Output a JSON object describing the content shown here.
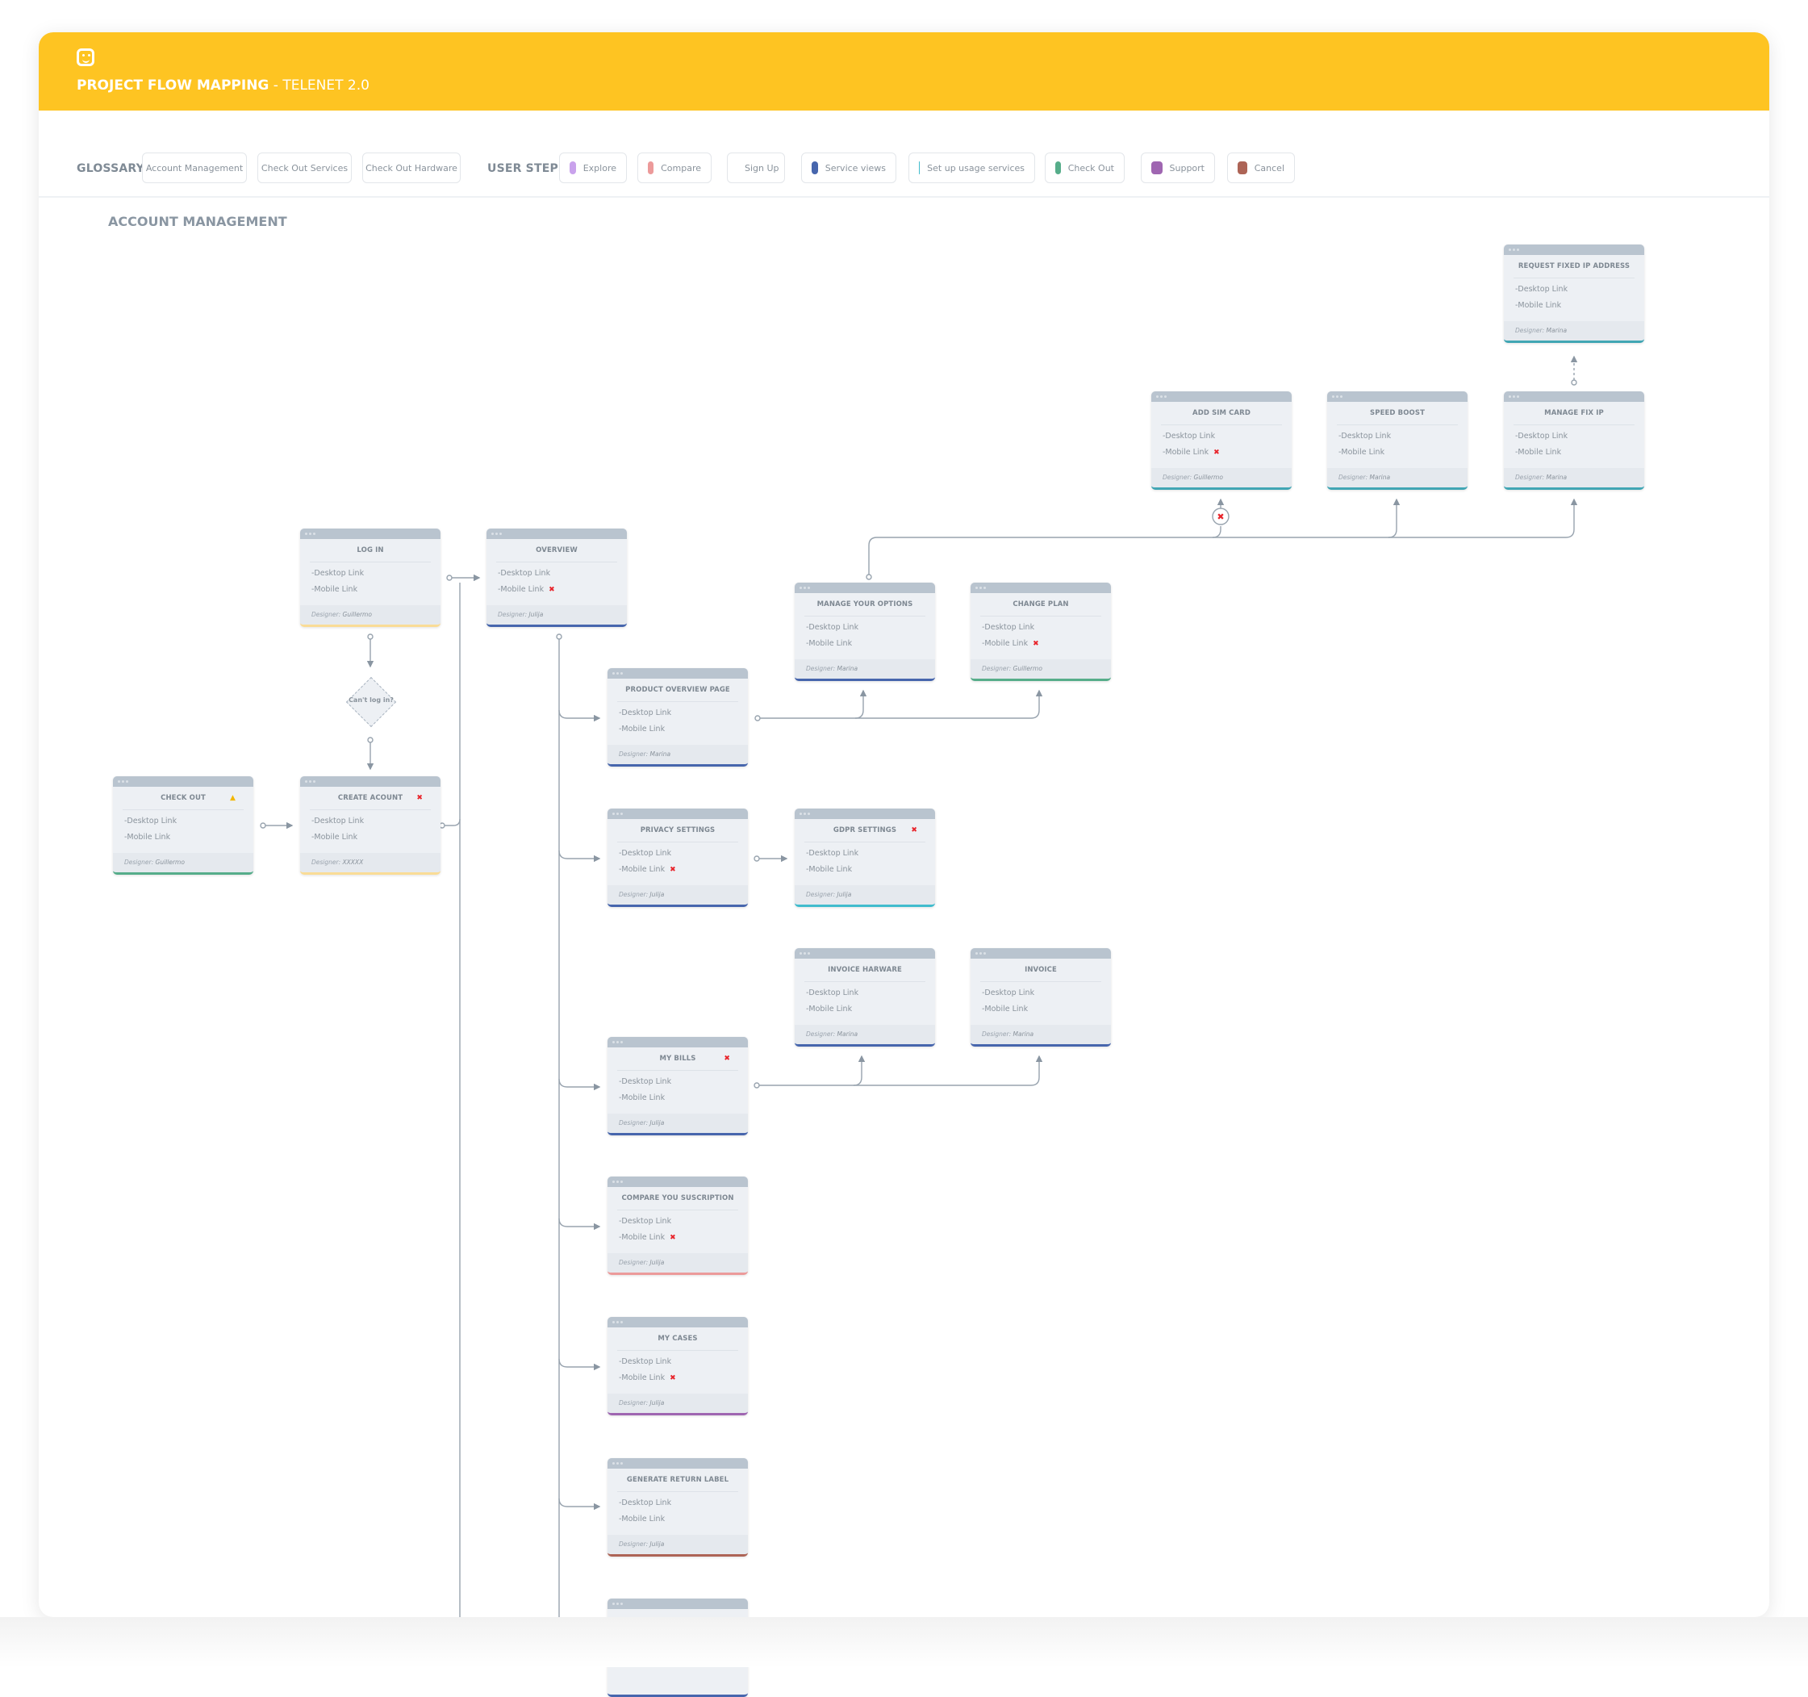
{
  "header": {
    "logo_icon": "telenet-smiley-icon",
    "title_bold": "PROJECT FLOW MAPPING",
    "title_rest": " - TELENET 2.0"
  },
  "toolbar": {
    "glossary_label": "GLOSSARY",
    "glossary": [
      "Account Management",
      "Check Out Services",
      "Check Out Hardware"
    ],
    "user_steps_label": "USER STEPS",
    "user_steps": [
      {
        "label": "Explore",
        "color": "#c9a2ec"
      },
      {
        "label": "Compare",
        "color": "#ec9a9a"
      },
      {
        "label": "Sign Up",
        "color": "#fadc96"
      },
      {
        "label": "Service views",
        "color": "#4766ad"
      },
      {
        "label": "Set up usage services",
        "color": "#41bccd"
      },
      {
        "label": "Check Out",
        "color": "#56ad8a"
      },
      {
        "label": "Support",
        "color": "#9f66b1"
      },
      {
        "label": "Cancel",
        "color": "#ad6456"
      }
    ]
  },
  "section": {
    "title": "ACCOUNT MANAGEMENT"
  },
  "common": {
    "desktop_link": "-Desktop Link",
    "mobile_link": "-Mobile Link",
    "designer_prefix": "Designer: ",
    "error_mark": "✖",
    "warning_mark": "▲"
  },
  "decision": {
    "label": "Can't log in?"
  },
  "cards": [
    {
      "id": "log-in",
      "title": "LOG IN",
      "designer": "Guillermo",
      "step_color": "#fadc96",
      "title_status": "",
      "mobile_error": false
    },
    {
      "id": "overview",
      "title": "OVERVIEW",
      "designer": "Julija",
      "step_color": "#4766ad",
      "title_status": "",
      "mobile_error": true
    },
    {
      "id": "check-out",
      "title": "CHECK OUT",
      "designer": "Guillermo",
      "step_color": "#56ad8a",
      "title_status": "warning",
      "mobile_error": false
    },
    {
      "id": "create-account",
      "title": "CREATE ACOUNT",
      "designer": "XXXXX",
      "step_color": "#fadc96",
      "title_status": "error",
      "mobile_error": false
    },
    {
      "id": "product-overview-page",
      "title": "PRODUCT OVERVIEW PAGE",
      "designer": "Marina",
      "step_color": "#4766ad",
      "title_status": "",
      "mobile_error": false
    },
    {
      "id": "privacy-settings",
      "title": "PRIVACY SETTINGS",
      "designer": "Julija",
      "step_color": "#4766ad",
      "title_status": "",
      "mobile_error": true
    },
    {
      "id": "my-bills",
      "title": "MY BILLS",
      "designer": "Julija",
      "step_color": "#4766ad",
      "title_status": "error",
      "mobile_error": false
    },
    {
      "id": "compare-subscription",
      "title": "COMPARE YOU SUSCRIPTION",
      "designer": "Julija",
      "step_color": "#ec9a9a",
      "title_status": "",
      "mobile_error": true
    },
    {
      "id": "my-cases",
      "title": "MY CASES",
      "designer": "Julija",
      "step_color": "#9f66b1",
      "title_status": "",
      "mobile_error": true
    },
    {
      "id": "generate-return-label",
      "title": "GENERATE RETURN LABEL",
      "designer": "Julija",
      "step_color": "#ad6456",
      "title_status": "",
      "mobile_error": false
    },
    {
      "id": "manage-your-options",
      "title": "MANAGE YOUR OPTIONS",
      "designer": "Marina",
      "step_color": "#4766ad",
      "title_status": "",
      "mobile_error": false
    },
    {
      "id": "change-plan",
      "title": "CHANGE PLAN",
      "designer": "Guillermo",
      "step_color": "#56ad8a",
      "title_status": "",
      "mobile_error": true
    },
    {
      "id": "gdpr-settings",
      "title": "GDPR SETTINGS",
      "designer": "Julija",
      "step_color": "#41bccd",
      "title_status": "error",
      "mobile_error": false
    },
    {
      "id": "invoice-hardware",
      "title": "INVOICE HARWARE",
      "designer": "Marina",
      "step_color": "#4766ad",
      "title_status": "",
      "mobile_error": false
    },
    {
      "id": "invoice",
      "title": "INVOICE",
      "designer": "Marina",
      "step_color": "#4766ad",
      "title_status": "",
      "mobile_error": false
    },
    {
      "id": "add-sim-card",
      "title": "ADD SIM CARD",
      "designer": "Guillermo",
      "step_color": "#41a6b4",
      "title_status": "",
      "mobile_error": true
    },
    {
      "id": "speed-boost",
      "title": "SPEED BOOST",
      "designer": "Marina",
      "step_color": "#41a6b4",
      "title_status": "",
      "mobile_error": false
    },
    {
      "id": "manage-fix-ip",
      "title": "MANAGE FIX IP",
      "designer": "Marina",
      "step_color": "#41a6b4",
      "title_status": "",
      "mobile_error": false
    },
    {
      "id": "request-fixed-ip-address",
      "title": "REQUEST FIXED IP ADDRESS",
      "designer": "Marina",
      "step_color": "#41a6b4",
      "title_status": "",
      "mobile_error": false
    }
  ]
}
